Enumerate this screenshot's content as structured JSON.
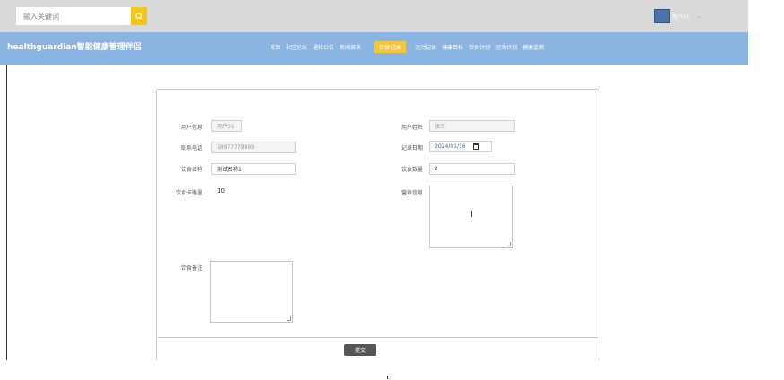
{
  "search": {
    "placeholder": "输入关键词"
  },
  "user": {
    "name": "用户01"
  },
  "brand": {
    "title": "healthguardian智能健康管理伴侣"
  },
  "nav": {
    "items": [
      "首页",
      "社区论坛",
      "通知公告",
      "新闻资讯",
      "饮食记录",
      "运动记录",
      "健康目标",
      "饮食计划",
      "运动计划",
      "健康监测"
    ],
    "active": "饮食记录"
  },
  "form": {
    "username_label": "用户信息",
    "username_value": "用户01",
    "realname_label": "用户姓名",
    "realname_value": "张三",
    "phone_label": "联系电话",
    "phone_value": "18977778899",
    "date_label": "记录日期",
    "date_year": "2024/",
    "date_month": "01",
    "date_sep": "/",
    "date_day": "16",
    "food_label": "饮食名称",
    "food_value": "测试名称1",
    "qty_label": "饮食数量",
    "qty_value": "2",
    "calorie_label": "饮食卡路里",
    "calorie_value": "10",
    "nutrition_label": "营养信息",
    "remark_label": "饮食备注",
    "submit_label": "提交"
  },
  "colors": {
    "accent": "#f4c536",
    "nav_bg": "#8ab4e2",
    "top_bg": "#d9d9d9"
  }
}
